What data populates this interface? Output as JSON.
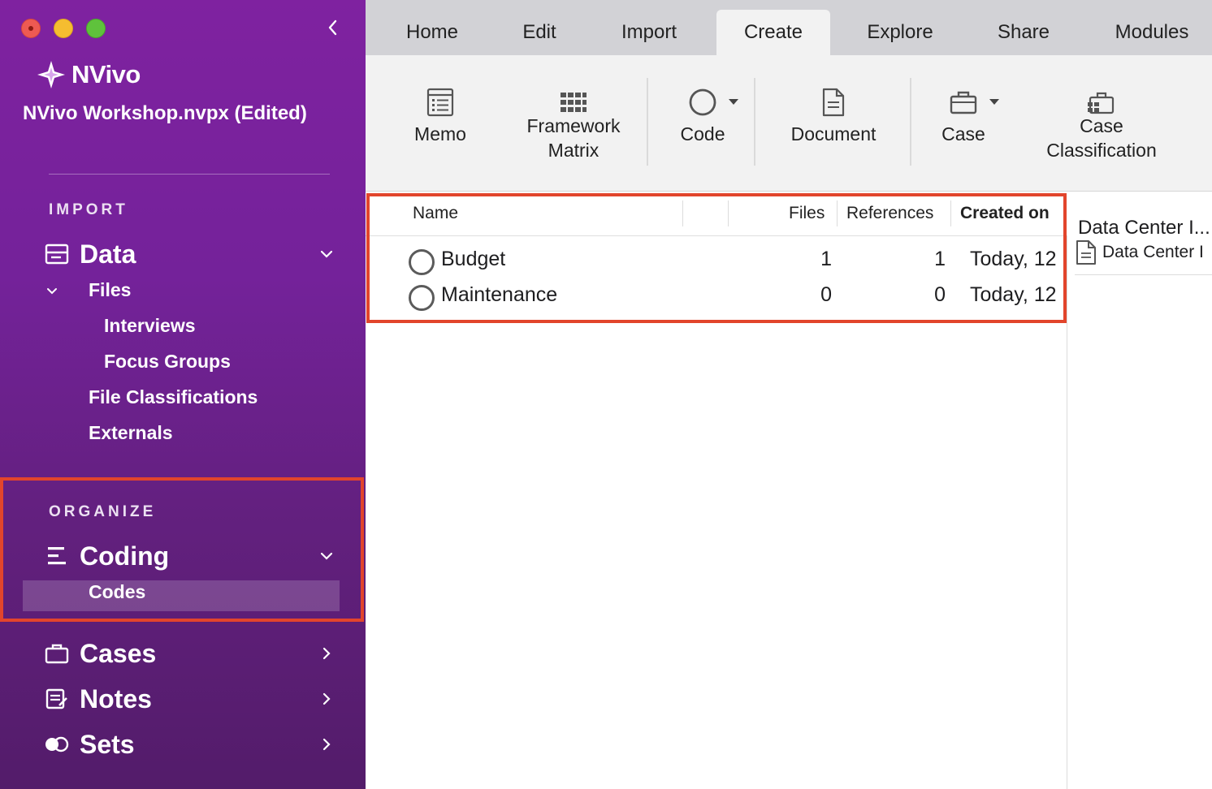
{
  "app": {
    "name": "NVivo",
    "project_title": "NVivo Workshop.nvpx (Edited)"
  },
  "sidebar": {
    "import_label": "IMPORT",
    "data_label": "Data",
    "files_label": "Files",
    "interviews_label": "Interviews",
    "focus_groups_label": "Focus Groups",
    "file_classifications_label": "File Classifications",
    "externals_label": "Externals",
    "organize_label": "ORGANIZE",
    "coding_label": "Coding",
    "codes_label": "Codes",
    "cases_label": "Cases",
    "notes_label": "Notes",
    "sets_label": "Sets"
  },
  "tabs": [
    "Home",
    "Edit",
    "Import",
    "Create",
    "Explore",
    "Share",
    "Modules"
  ],
  "active_tab": "Create",
  "ribbon": {
    "memo": "Memo",
    "framework_matrix": "Framework\nMatrix",
    "code": "Code",
    "document": "Document",
    "case": "Case",
    "case_classification": "Case\nClassification"
  },
  "table": {
    "columns": {
      "name": "Name",
      "files": "Files",
      "references": "References",
      "created_on": "Created on"
    },
    "rows": [
      {
        "name": "Budget",
        "files": "1",
        "references": "1",
        "created_on": "Today, 12"
      },
      {
        "name": "Maintenance",
        "files": "0",
        "references": "0",
        "created_on": "Today, 12"
      }
    ]
  },
  "preview": {
    "title": "Data Center I...",
    "doc_label": "Data Center I"
  },
  "colors": {
    "sidebar_top": "#7f22a0",
    "sidebar_bottom": "#531c6a",
    "highlight_box": "#e2452c",
    "tabbar_bg": "#d2d2d6",
    "ribbon_bg": "#f2f2f2"
  }
}
